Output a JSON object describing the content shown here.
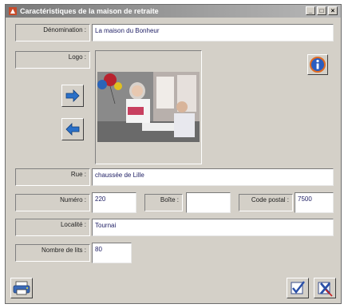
{
  "window": {
    "title": "Caractéristiques de la maison de retraite",
    "minimize_glyph": "_",
    "maximize_glyph": "□",
    "close_glyph": "×"
  },
  "form": {
    "name_label": "Dénomination :",
    "name_value": "La maison du Bonheur",
    "logo_label": "Logo :",
    "street_label": "Rue :",
    "street_value": "chaussée de Lille",
    "number_label": "Numéro :",
    "number_value": "220",
    "box_label": "Boîte :",
    "box_value": "",
    "postal_label": "Code postal :",
    "postal_value": "7500",
    "locality_label": "Localité :",
    "locality_value": "Tournai",
    "beds_label": "Nombre de lits :",
    "beds_value": "80"
  },
  "icons": {
    "info": "info-icon",
    "next": "arrow-right-icon",
    "previous": "arrow-left-icon",
    "print": "printer-icon",
    "validate": "checkmark-icon",
    "cancel": "cancel-icon"
  },
  "colors": {
    "window_bg": "#d4d0c8",
    "field_text": "#1e1e64",
    "arrow_blue": "#2a70c8"
  }
}
